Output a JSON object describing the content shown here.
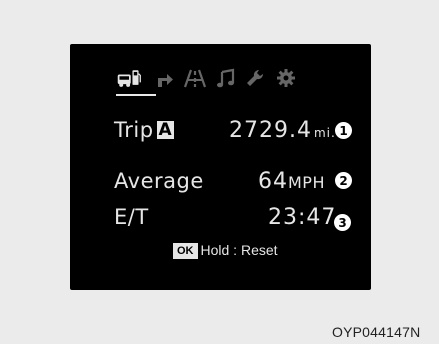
{
  "display": {
    "tabs": [
      {
        "icon": "trip-computer-icon",
        "active": true
      },
      {
        "icon": "turn-arrow-icon",
        "active": false
      },
      {
        "icon": "lane-road-icon",
        "active": false
      },
      {
        "icon": "music-note-icon",
        "active": false
      },
      {
        "icon": "wrench-icon",
        "active": false
      },
      {
        "icon": "gear-icon",
        "active": false
      }
    ],
    "trip": {
      "label": "Trip",
      "badge": "A",
      "value": "2729.4",
      "unit": "mi.",
      "callout": "1"
    },
    "average": {
      "label": "Average",
      "value": "64",
      "unit": "MPH",
      "callout": "2"
    },
    "elapsed": {
      "label": "E/T",
      "value": "23:47",
      "callout": "3"
    },
    "reset_hint": {
      "key": "OK",
      "text": "Hold : Reset"
    }
  },
  "figure_code": "OYP044147N",
  "colors": {
    "screen": "#000000",
    "text": "#e6e6e6",
    "page": "#ebebeb"
  }
}
